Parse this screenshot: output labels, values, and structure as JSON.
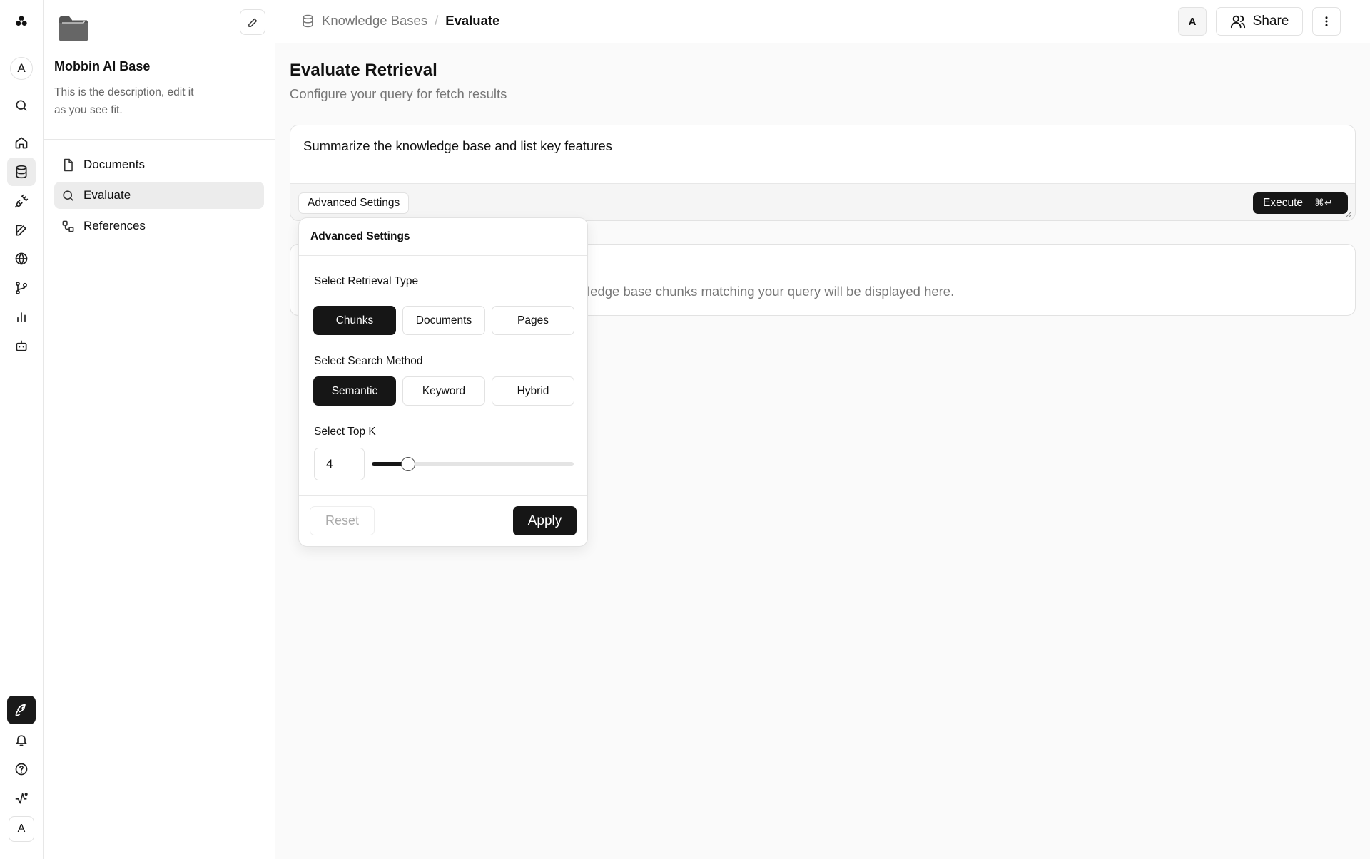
{
  "rail": {
    "avatar_top": "A",
    "avatar_bottom": "A",
    "icons_top": [
      "logo-icon",
      "search-icon",
      "home-icon",
      "database-icon",
      "plug-icon",
      "edit-icon",
      "globe-icon",
      "git-branch-icon",
      "bar-chart-icon",
      "bot-icon"
    ],
    "icons_bottom": [
      "rocket-icon",
      "bell-icon",
      "help-icon",
      "activity-icon"
    ]
  },
  "sidebar": {
    "title": "Mobbin AI Base",
    "description": "This is the description, edit it as you see fit.",
    "items": [
      {
        "label": "Documents",
        "icon": "file-icon"
      },
      {
        "label": "Evaluate",
        "icon": "search-icon",
        "active": true
      },
      {
        "label": "References",
        "icon": "references-icon"
      }
    ]
  },
  "topbar": {
    "breadcrumb_root": "Knowledge Bases",
    "breadcrumb_separator": "/",
    "breadcrumb_current": "Evaluate",
    "avatar": "A",
    "share_label": "Share"
  },
  "main": {
    "title": "Evaluate Retrieval",
    "subtitle": "Configure your query for fetch results",
    "query_text": "Summarize the knowledge base and list key features",
    "advanced_settings_label": "Advanced Settings",
    "execute_label": "Execute",
    "execute_shortcut": "⌘↵",
    "results_placeholder": "ant knowledge base chunks matching your query will be displayed here."
  },
  "popover": {
    "title": "Advanced Settings",
    "retrieval_type_label": "Select Retrieval Type",
    "retrieval_types": [
      "Chunks",
      "Documents",
      "Pages"
    ],
    "retrieval_type_selected": "Chunks",
    "search_method_label": "Select Search Method",
    "search_methods": [
      "Semantic",
      "Keyword",
      "Hybrid"
    ],
    "search_method_selected": "Semantic",
    "top_k_label": "Select Top K",
    "top_k_value": "4",
    "top_k_slider_fraction": 0.18,
    "reset_label": "Reset",
    "apply_label": "Apply"
  },
  "colors": {
    "accent": "#161616",
    "active_bg": "#ececec",
    "border": "#e2e2e2",
    "muted_text": "#777777"
  }
}
